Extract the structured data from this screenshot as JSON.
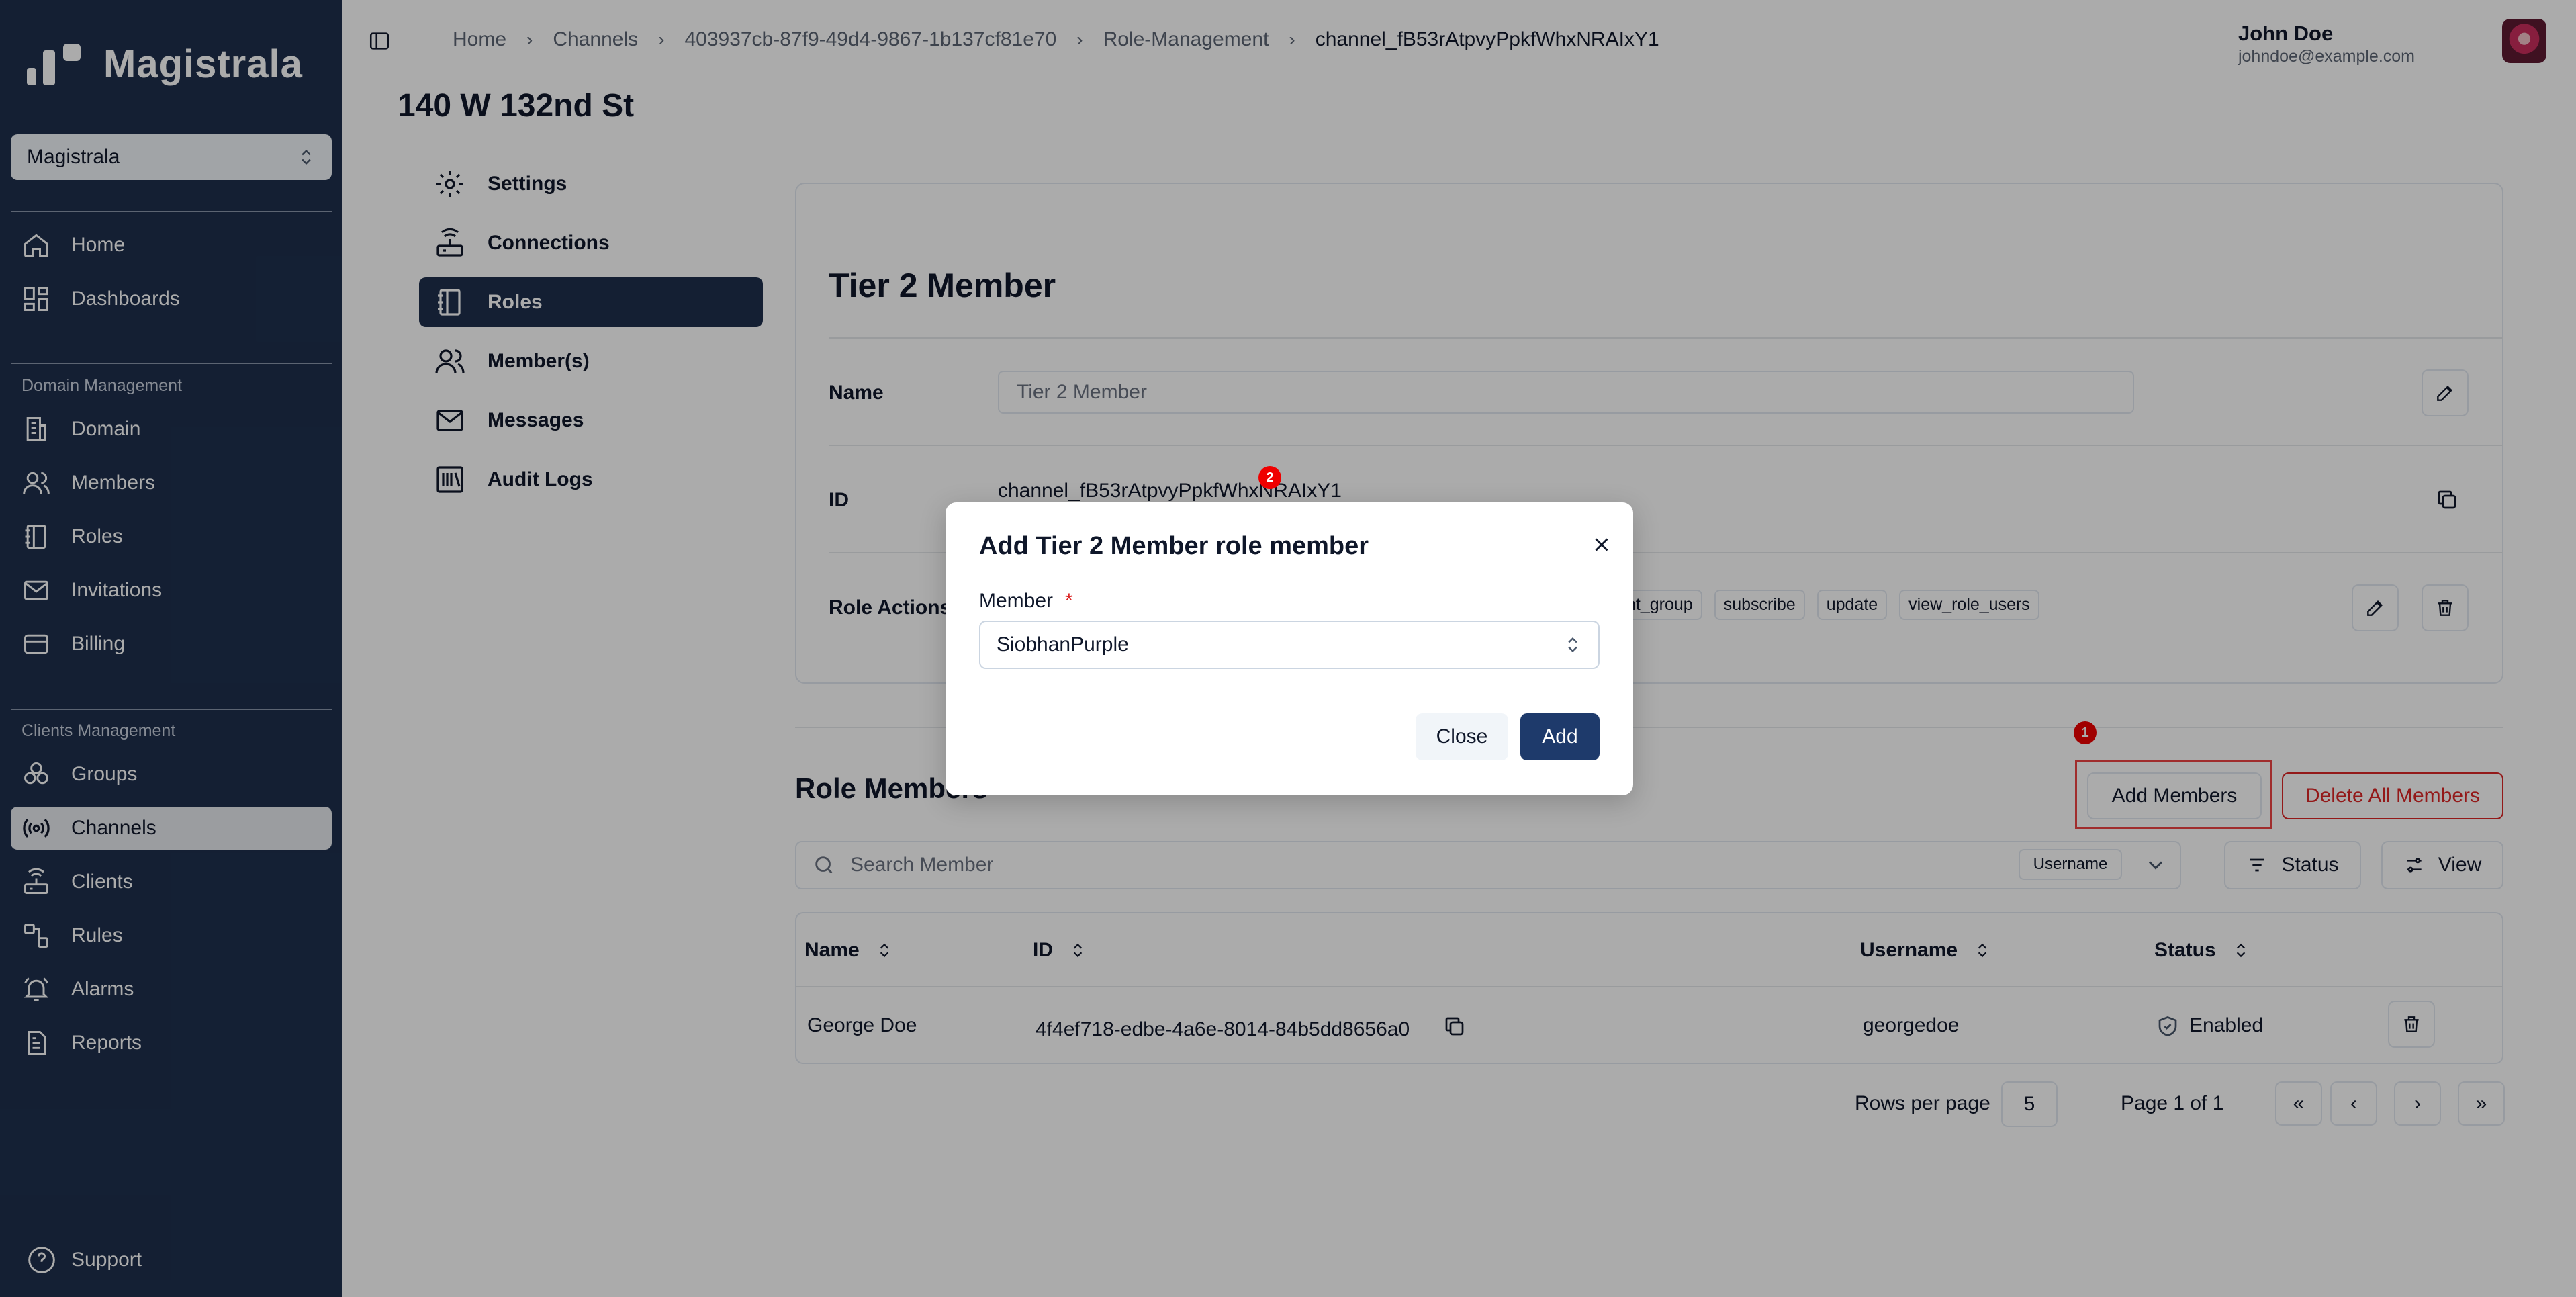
{
  "app": {
    "name": "Magistrala"
  },
  "sidebar": {
    "domain_selector": "Magistrala",
    "primary": [
      {
        "label": "Home",
        "icon": "home-icon"
      },
      {
        "label": "Dashboards",
        "icon": "dashboard-icon"
      }
    ],
    "domain_section": "Domain Management",
    "domain_items": [
      {
        "label": "Domain",
        "icon": "building-icon"
      },
      {
        "label": "Members",
        "icon": "users-icon"
      },
      {
        "label": "Roles",
        "icon": "notebook-icon"
      },
      {
        "label": "Invitations",
        "icon": "mail-icon"
      },
      {
        "label": "Billing",
        "icon": "credit-card-icon"
      }
    ],
    "clients_section": "Clients Management",
    "clients_items": [
      {
        "label": "Groups",
        "icon": "groups-icon"
      },
      {
        "label": "Channels",
        "icon": "broadcast-icon",
        "active": true
      },
      {
        "label": "Clients",
        "icon": "router-icon"
      },
      {
        "label": "Rules",
        "icon": "workflow-icon"
      },
      {
        "label": "Alarms",
        "icon": "bell-icon"
      },
      {
        "label": "Reports",
        "icon": "report-icon"
      }
    ],
    "support": "Support"
  },
  "header": {
    "breadcrumb": [
      "Home",
      "Channels",
      "403937cb-87f9-49d4-9867-1b137cf81e70",
      "Role-Management",
      "channel_fB53rAtpvyPpkfWhxNRAIxY1"
    ],
    "user_name": "John Doe",
    "user_email": "johndoe@example.com"
  },
  "page": {
    "title": "140 W 132nd St"
  },
  "subnav": [
    {
      "label": "Settings",
      "icon": "gear-icon"
    },
    {
      "label": "Connections",
      "icon": "router-icon"
    },
    {
      "label": "Roles",
      "icon": "notebook-icon",
      "active": true
    },
    {
      "label": "Member(s)",
      "icon": "users-icon"
    },
    {
      "label": "Messages",
      "icon": "mail-icon"
    },
    {
      "label": "Audit Logs",
      "icon": "logs-icon"
    }
  ],
  "role": {
    "title": "Tier 2 Member",
    "name_label": "Name",
    "name_value": "Tier 2 Member",
    "id_label": "ID",
    "id_value": "channel_fB53rAtpvyPpkfWhxNRAIxY1",
    "actions_label": "Role Actions",
    "actions": [
      "nt_group",
      "subscribe",
      "update",
      "view_role_users"
    ]
  },
  "members": {
    "title": "Role Members",
    "add_button": "Add Members",
    "delete_all_button": "Delete All Members",
    "search_placeholder": "Search Member",
    "search_field": "Username",
    "status_button": "Status",
    "view_button": "View",
    "columns": [
      "Name",
      "ID",
      "Username",
      "Status"
    ],
    "rows": [
      {
        "name": "George Doe",
        "id": "4f4ef718-edbe-4a6e-8014-84b5dd8656a0",
        "username": "georgedoe",
        "status": "Enabled"
      }
    ],
    "rows_per_page_label": "Rows per page",
    "rows_per_page": "5",
    "page_label": "Page 1 of 1"
  },
  "dialog": {
    "title": "Add Tier 2 Member role member",
    "member_label": "Member",
    "required_mark": "*",
    "member_value": "SiobhanPurple",
    "close_button": "Close",
    "add_button": "Add"
  },
  "annotations": {
    "badge_1": "1",
    "badge_2": "2"
  },
  "colors": {
    "sidebar": "#1e2f4d",
    "primary": "#1e3a6b",
    "danger": "#dc2626",
    "badge": "#ef0000"
  }
}
